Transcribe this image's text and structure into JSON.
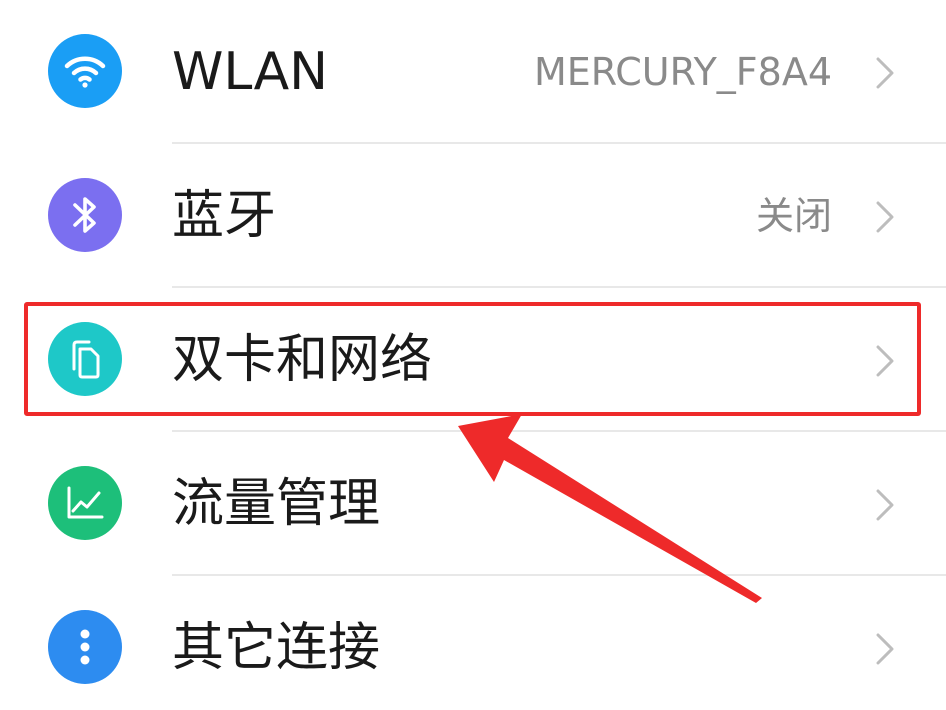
{
  "settings": {
    "items": [
      {
        "label": "WLAN",
        "value": "MERCURY_F8A4",
        "icon": "wifi-icon",
        "icon_color": "#1a9ef5"
      },
      {
        "label": "蓝牙",
        "value": "关闭",
        "icon": "bluetooth-icon",
        "icon_color": "#7b6ff0"
      },
      {
        "label": "双卡和网络",
        "value": "",
        "icon": "sim-cards-icon",
        "icon_color": "#1ec8c8"
      },
      {
        "label": "流量管理",
        "value": "",
        "icon": "traffic-chart-icon",
        "icon_color": "#1dbf7a"
      },
      {
        "label": "其它连接",
        "value": "",
        "icon": "more-dots-icon",
        "icon_color": "#2d8cf0"
      }
    ]
  },
  "annotation": {
    "highlight_color": "#ee2a2a",
    "highlighted_item": "双卡和网络"
  }
}
